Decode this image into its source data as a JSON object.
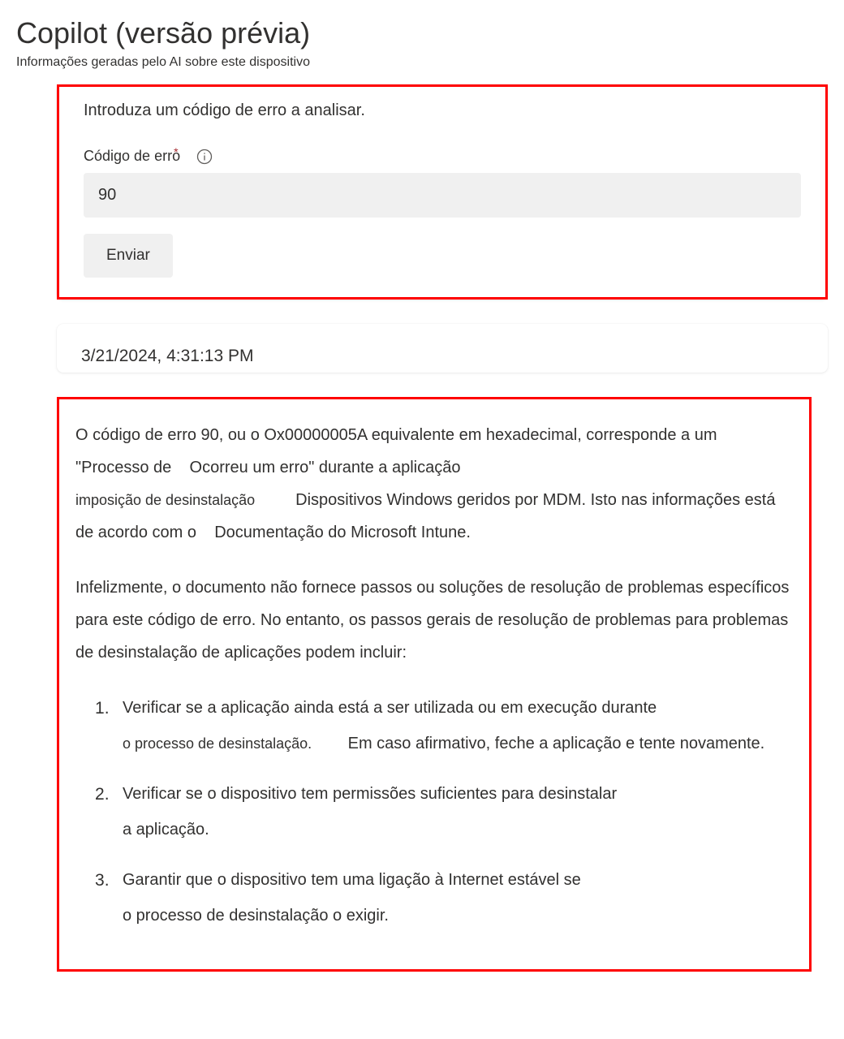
{
  "header": {
    "title": "Copilot (versão prévia)",
    "subtitle": "Informações geradas pelo AI sobre este dispositivo"
  },
  "input_card": {
    "instruction": "Introduza um código de erro a analisar.",
    "field_label": "Código de erro",
    "required_marker": "*",
    "input_value": "90",
    "submit_label": "Enviar"
  },
  "response": {
    "timestamp": "3/21/2024, 4:31:13 PM",
    "paragraph1_a": "O código de erro 90, ou o Ox00000005A equivalente em hexadecimal, corresponde a um \"Processo de",
    "paragraph1_b": "Ocorreu um erro\" durante a aplicação",
    "paragraph1_c": "imposição de desinstalação",
    "paragraph1_d": "Dispositivos Windows geridos por MDM. Isto nas informações está de acordo com o",
    "paragraph1_e": "Documentação do Microsoft Intune.",
    "paragraph2": "Infelizmente, o documento não fornece passos ou soluções de resolução de problemas específicos para este código de erro. No entanto, os passos gerais de resolução de problemas para problemas de desinstalação de aplicações podem incluir:",
    "steps": [
      {
        "line1": "Verificar se a aplicação ainda está a ser utilizada ou em execução durante",
        "line2a": "o processo de desinstalação.",
        "line2b": "Em caso afirmativo, feche a aplicação e tente novamente."
      },
      {
        "line1": "Verificar se o dispositivo tem permissões suficientes para desinstalar",
        "line2": "a aplicação."
      },
      {
        "line1": "Garantir que o dispositivo tem uma ligação à Internet estável se",
        "line2": "o processo de desinstalação o exigir."
      }
    ]
  }
}
